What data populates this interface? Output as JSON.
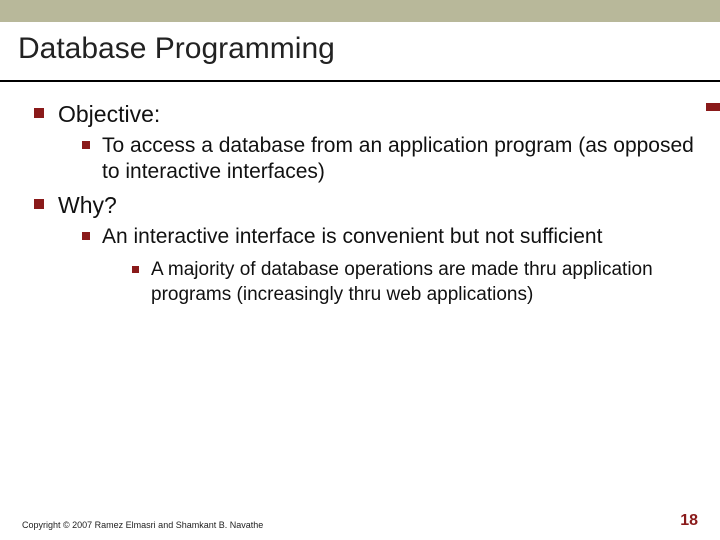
{
  "slide": {
    "title": "Database Programming",
    "bullets": {
      "b1": "Objective:",
      "b1_1": "To access a database from an application program (as opposed to interactive interfaces)",
      "b2": "Why?",
      "b2_1": "An interactive interface is convenient but not sufficient",
      "b2_1_1": "A majority of database operations are made thru application programs (increasingly thru web applications)"
    },
    "copyright": "Copyright © 2007 Ramez Elmasri and Shamkant B. Navathe",
    "page_number": "18"
  }
}
